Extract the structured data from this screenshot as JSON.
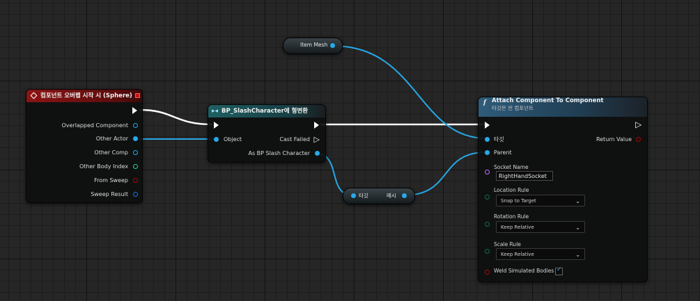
{
  "event_node": {
    "title": "컴포넌트 오버랩 시작 시 (Sphere)",
    "pins": [
      "Overlapped Component",
      "Other Actor",
      "Other Comp",
      "Other Body Index",
      "From Sweep",
      "Sweep Result"
    ]
  },
  "cast_node": {
    "title": "BP_SlashCharacter에 형변환",
    "object_label": "Object",
    "cast_failed_label": "Cast Failed",
    "output_label": "As BP Slash Character"
  },
  "item_mesh_node": {
    "label": "Item Mesh"
  },
  "mesh_node": {
    "input_label": "타깃",
    "output_label": "메시"
  },
  "attach_node": {
    "title": "Attach Component To Component",
    "subtitle": "타깃은 씬 컴포넌트",
    "target_label": "타깃",
    "parent_label": "Parent",
    "return_label": "Return Value",
    "socket_name_label": "Socket Name",
    "socket_name_value": "RightHandSocket",
    "location_rule_label": "Location Rule",
    "location_rule_value": "Snap to Target",
    "rotation_rule_label": "Rotation Rule",
    "rotation_rule_value": "Keep Relative",
    "scale_rule_label": "Scale Rule",
    "scale_rule_value": "Keep Relative",
    "weld_label": "Weld Simulated Bodies",
    "weld_checked": true
  },
  "colors": {
    "object_pin": "#27a9e8",
    "int_pin": "#1dd49b",
    "bool_pin": "#930000",
    "struct_pin": "#0057c8",
    "exec": "#ffffff",
    "event_header": "#8c1414",
    "function_header": "#2e5c7a",
    "cast_header": "#1f5f62"
  },
  "icons": [
    "event-diamond-icon",
    "cast-icon",
    "function-icon",
    "exec-pin-icon",
    "chevron-down-icon",
    "checkmark-icon"
  ]
}
